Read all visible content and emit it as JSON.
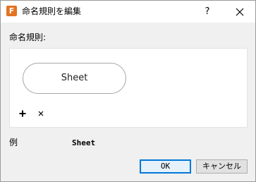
{
  "window": {
    "title": "命名規則を編集",
    "app_icon_glyph": "F",
    "app_icon_color": "#e37321",
    "help_label": "?",
    "close_icon": "close-icon"
  },
  "rule": {
    "label": "命名規則:",
    "tokens": [
      "Sheet"
    ],
    "add_icon": "plus-icon",
    "remove_icon": "close-icon"
  },
  "example": {
    "label": "例",
    "value": "Sheet"
  },
  "buttons": {
    "ok_label": "OK",
    "cancel_label": "キャンセル",
    "focus_color": "#0078d7"
  }
}
